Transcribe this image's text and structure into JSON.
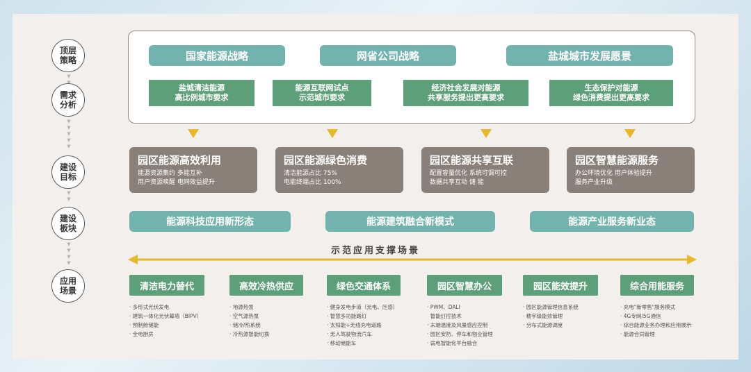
{
  "stages": [
    {
      "label": "顶层\n策略"
    },
    {
      "label": "需求\n分析"
    },
    {
      "label": "建设\n目标"
    },
    {
      "label": "建设\n板块"
    },
    {
      "label": "应用\n场景"
    }
  ],
  "strategies": [
    "国家能源战略",
    "网省公司战略",
    "盐城城市发展愿景"
  ],
  "demands": [
    "盐城清洁能源\n高比例城市要求",
    "能源互联网试点\n示范城市要求",
    "经济社会发展对能源\n共享服务提出更高要求",
    "生态保护对能源\n绿色消费提出更高要求"
  ],
  "goals": [
    {
      "title": "园区能源高效利用",
      "desc": "能源资源集约      多能互补\n用户资源唤醒      电网效益提升"
    },
    {
      "title": "园区能源绿色消费",
      "desc": "清洁能源占比 75%\n电能终端占比 100%"
    },
    {
      "title": "园区能源共享互联",
      "desc": "配置容量优化      系统可调可控\n数据共享互动      储 能"
    },
    {
      "title": "园区智慧能源服务",
      "desc": "办公环境优化      用户体验提升\n服务产业升级"
    }
  ],
  "sectors": [
    "能源科技应用新形态",
    "能源建筑融合新模式",
    "能源产业服务新业态"
  ],
  "scene_title": "示范应用支撑场景",
  "applications": [
    {
      "title": "清洁电力替代",
      "items": [
        "多形式光伏发电",
        "建筑一体化光伏幕墙（BIPV）",
        "预制舱储能",
        "全电厨房"
      ]
    },
    {
      "title": "高效冷热供应",
      "items": [
        "地源热泵",
        "空气源热泵",
        "储冷/热系统",
        "冷热源智能切换"
      ]
    },
    {
      "title": "绿色交通体系",
      "items": [
        "健身发电步道（光电、压感）",
        "智慧多功能路灯",
        "太阳能+无线充电道路",
        "无人驾驶物流汽车",
        "移动储能车"
      ]
    },
    {
      "title": "园区智慧办公",
      "items": [
        "PWM、DALI",
        "智能灯控技术",
        "末端温度及风量感应控制",
        "园区安防、停车和物业管理",
        "弱电智能化平台融合"
      ]
    },
    {
      "title": "园区能效提升",
      "items": [
        "园区能源管理信息系统",
        "楼宇级能效管理",
        "分布式能源调度"
      ]
    },
    {
      "title": "综合用能服务",
      "items": [
        "充电\"新零售\"服务模式",
        "4G专网/5G通信",
        "综合能源业务办理和应用展示",
        "能源合同管理"
      ]
    }
  ],
  "colors": {
    "teal": "#72b3ad",
    "green": "#5c9f79",
    "gray": "#888079",
    "arrow": "#e5b92b"
  }
}
